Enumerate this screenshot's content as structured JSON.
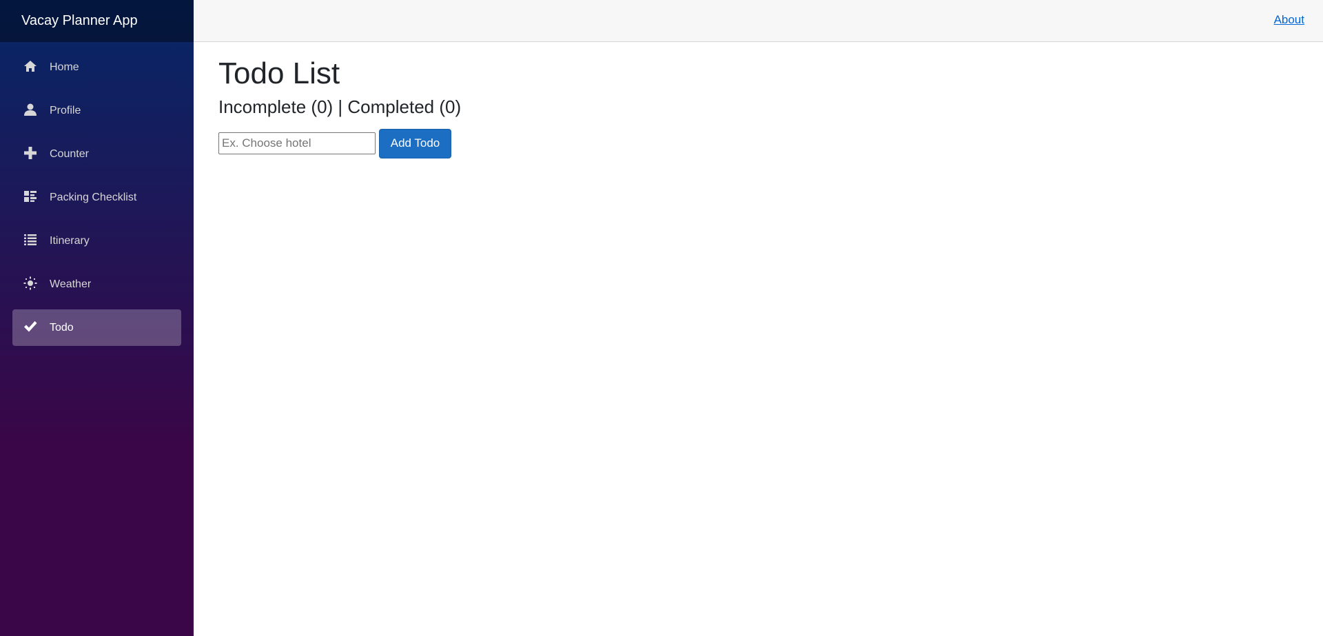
{
  "app": {
    "title": "Vacay Planner App"
  },
  "topbar": {
    "about_label": "About"
  },
  "sidebar": {
    "items": [
      {
        "label": "Home",
        "icon": "home-icon",
        "active": false
      },
      {
        "label": "Profile",
        "icon": "person-icon",
        "active": false
      },
      {
        "label": "Counter",
        "icon": "plus-icon",
        "active": false
      },
      {
        "label": "Packing Checklist",
        "icon": "dashboard-icon",
        "active": false
      },
      {
        "label": "Itinerary",
        "icon": "list-icon",
        "active": false
      },
      {
        "label": "Weather",
        "icon": "sun-icon",
        "active": false
      },
      {
        "label": "Todo",
        "icon": "check-icon",
        "active": true
      }
    ]
  },
  "main": {
    "title": "Todo List",
    "summary": "Incomplete (0) | Completed (0)",
    "input_placeholder": "Ex. Choose hotel",
    "add_button_label": "Add Todo"
  },
  "colors": {
    "sidebar_top": "#052767",
    "sidebar_bottom": "#3a0647",
    "primary_button": "#1b6ec2",
    "link": "#0366d6"
  }
}
